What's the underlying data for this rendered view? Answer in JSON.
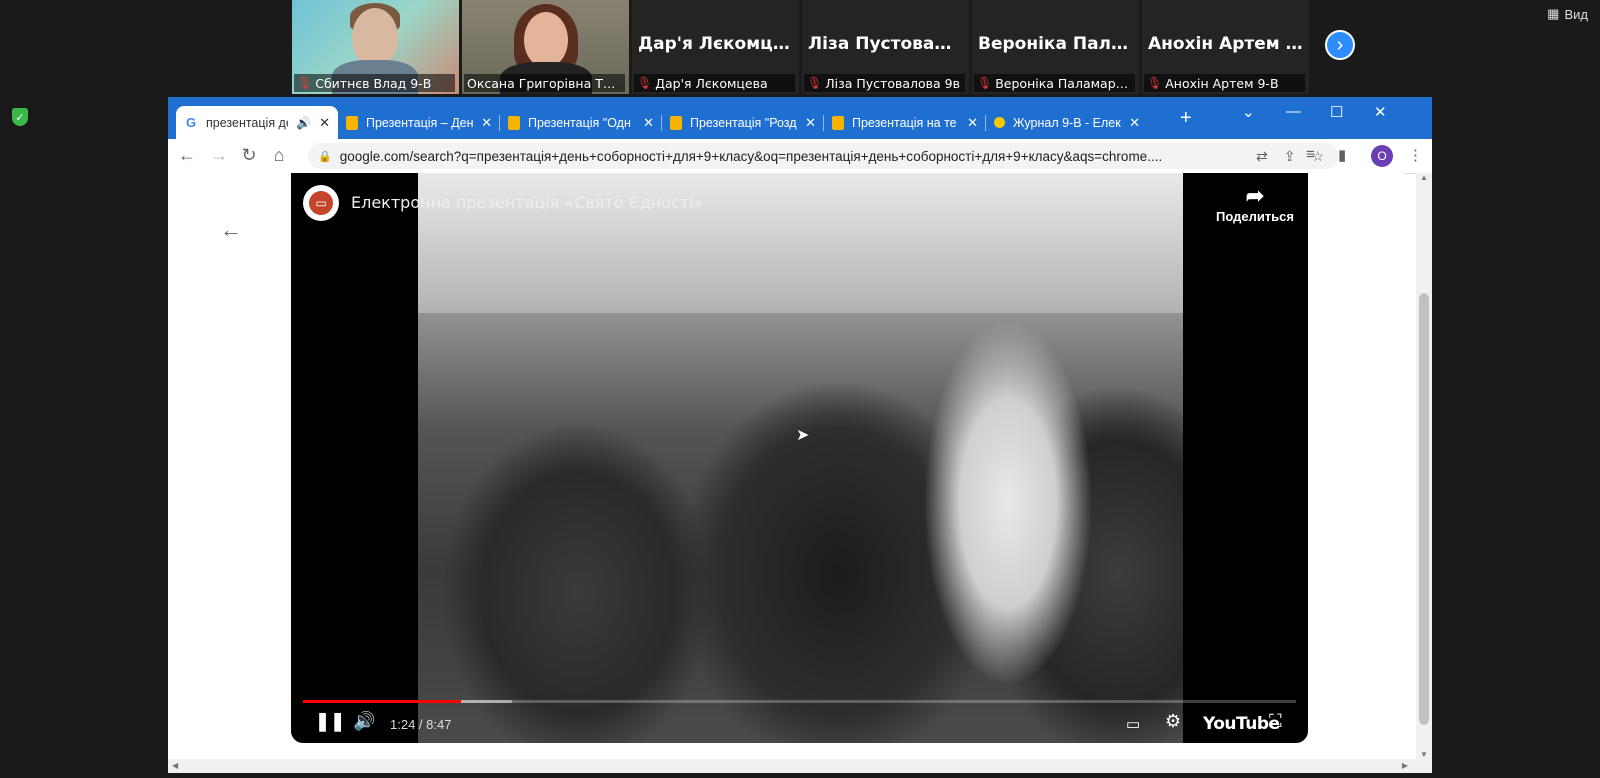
{
  "zoom": {
    "participants": [
      {
        "name": "Сбитнєв Влад 9-В",
        "has_video": true,
        "avatar": 1,
        "active": false
      },
      {
        "name": "Оксана Григорівна Тимо...",
        "has_video": true,
        "avatar": 2,
        "active": true
      },
      {
        "name": "Дар'я Лєкомцева",
        "display": "Дар'я Лєкомцева",
        "has_video": false
      },
      {
        "name": "Ліза Пустовалова 9в",
        "display": "Ліза Пустовало...",
        "has_video": false
      },
      {
        "name": "Вероніка Паламарчук",
        "display": "Вероніка Пала...",
        "has_video": false
      },
      {
        "name": "Анохін Артем 9-В",
        "display": "Анохін Артем 9...",
        "has_video": false
      }
    ],
    "next_icon": "chevron-right-icon",
    "view_label": "Вид"
  },
  "chrome": {
    "tabs": [
      {
        "title": "презентація де",
        "favicon": "google",
        "active": true,
        "audio": true
      },
      {
        "title": "Презентація – Ден",
        "favicon": "slides"
      },
      {
        "title": "Презентація \"Одн",
        "favicon": "slides"
      },
      {
        "title": "Презентація \"Розд",
        "favicon": "slides"
      },
      {
        "title": "Презентація на те",
        "favicon": "slides"
      },
      {
        "title": "Журнал 9-В - Елек",
        "favicon": "dot"
      }
    ],
    "url": "google.com/search?q=презентація+день+соборності+для+9+класу&oq=презентація+день+соборності+для+9+класу&aqs=chrome....",
    "profile_initial": "O"
  },
  "video": {
    "title": "Електронна презентація «Свято Єдності»",
    "share_label": "Поделиться",
    "time": "1:24 / 8:47",
    "brand": "YouTube",
    "progress_fraction": 0.159,
    "buffered_fraction": 0.21
  }
}
